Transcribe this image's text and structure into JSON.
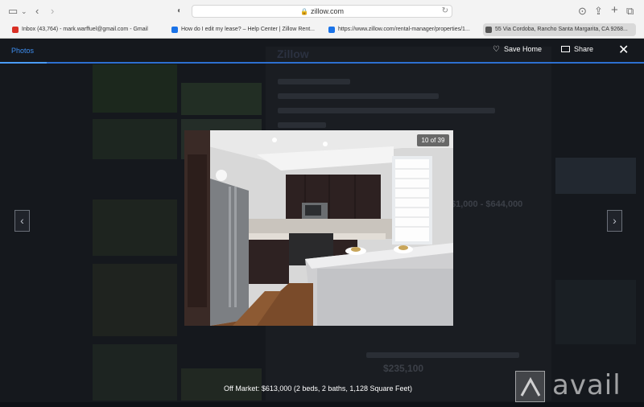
{
  "browser": {
    "url": "zillow.com",
    "tabs": [
      {
        "label": "Inbox (43,764) - mark.warffuel@gmail.com - Gmail",
        "favicon_color": "#d93025"
      },
      {
        "label": "How do I edit my lease? – Help Center | Zillow Rent...",
        "favicon_color": "#1a73e8"
      },
      {
        "label": "https://www.zillow.com/rental-manager/properties/1...",
        "favicon_color": "#1a73e8"
      },
      {
        "label": "55 Via Cordoba, Rancho Santa Margarita, CA 9268...",
        "favicon_color": "#555555"
      }
    ]
  },
  "modal": {
    "photos_tab": "Photos",
    "save_label": "Save Home",
    "share_label": "Share",
    "close_icon": "close-icon",
    "counter": "10 of 39",
    "caption": "Off Market: $613,000 (2 beds, 2 baths, 1,128 Square Feet)"
  },
  "background": {
    "brand": "Zillow",
    "estimate_range": "$1,000 - $644,000",
    "price_hint": "$235,100"
  },
  "watermark": {
    "word": "avail"
  },
  "colors": {
    "accent": "#3d8ef0"
  }
}
